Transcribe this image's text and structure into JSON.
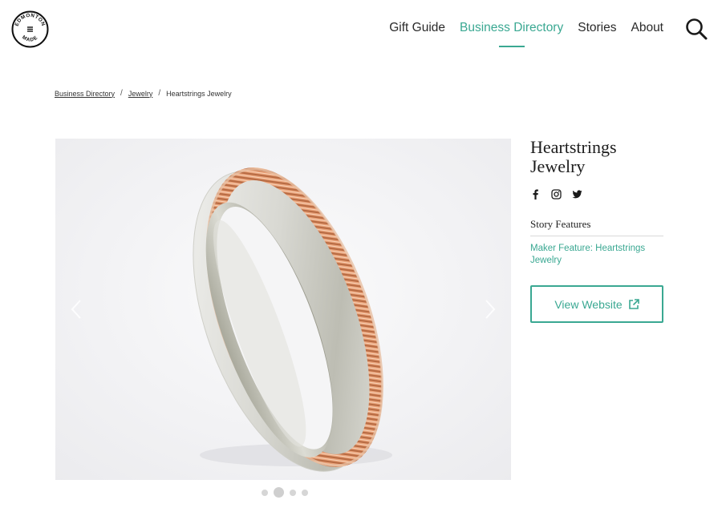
{
  "brand": {
    "logo_top": "EDMONTON",
    "logo_bottom": "MADE",
    "logo_icon": "menu-lines-icon"
  },
  "nav": {
    "items": [
      {
        "label": "Gift Guide",
        "active": false
      },
      {
        "label": "Business Directory",
        "active": true
      },
      {
        "label": "Stories",
        "active": false
      },
      {
        "label": "About",
        "active": false
      }
    ],
    "search_icon": "search-icon"
  },
  "breadcrumb": {
    "items": [
      {
        "label": "Business Directory",
        "link": true
      },
      {
        "label": "Jewelry",
        "link": true
      },
      {
        "label": "Heartstrings Jewelry",
        "link": false
      }
    ],
    "separator": "/"
  },
  "carousel": {
    "image_subject": "silver and copper guitar-string ring",
    "slide_count": 4,
    "active_slide": 2
  },
  "business": {
    "title": "Heartstrings Jewelry",
    "socials": [
      "facebook-icon",
      "instagram-icon",
      "twitter-icon"
    ],
    "story_heading": "Story Features",
    "story_link": "Maker Feature: Heartstrings Jewelry",
    "website_button": "View Website"
  },
  "colors": {
    "accent": "#3aa892",
    "text": "#222222",
    "image_bg": "#f3f3f5"
  }
}
